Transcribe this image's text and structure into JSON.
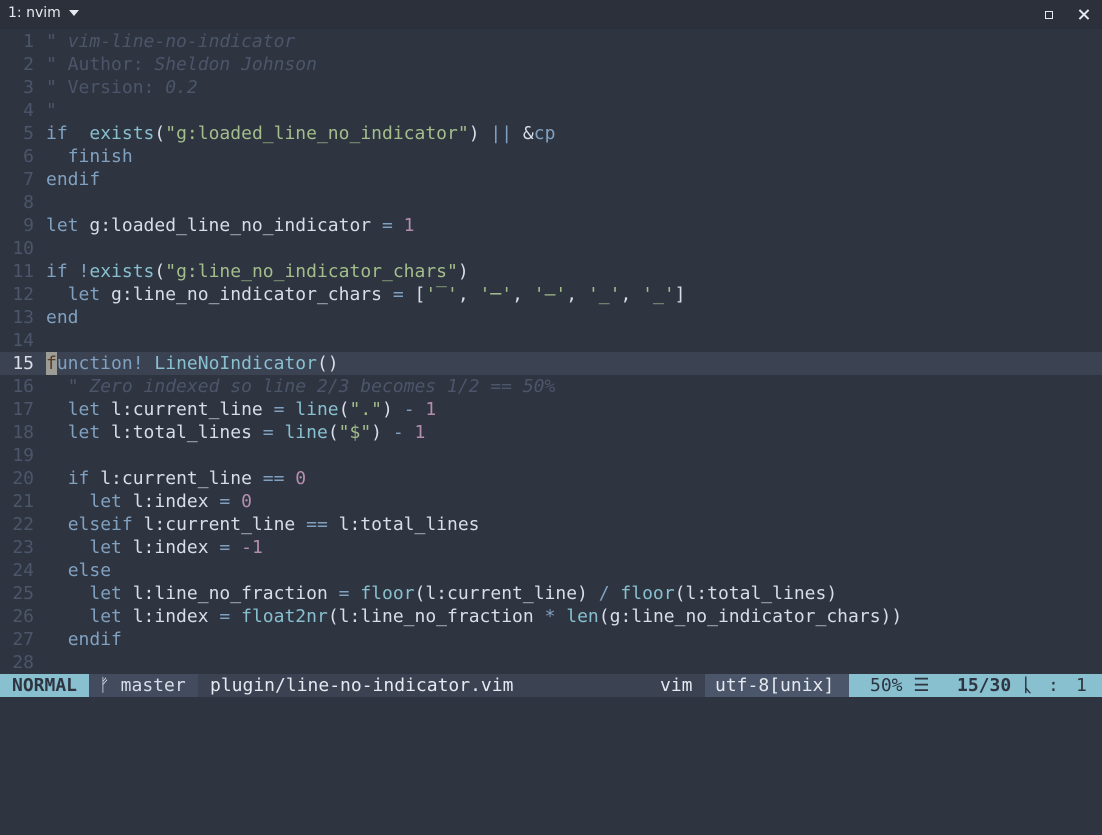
{
  "window": {
    "tab_title": "1: nvim",
    "icons": {
      "dropdown": "caret-down",
      "maximize": "square",
      "close": "x"
    }
  },
  "editor": {
    "lines": [
      {
        "n": "1",
        "t": [
          [
            "cmt-plain",
            "\" "
          ],
          [
            "cmt",
            "vim-line-no-indicator"
          ]
        ]
      },
      {
        "n": "2",
        "t": [
          [
            "cmt-plain",
            "\" Author: "
          ],
          [
            "cmt",
            "Sheldon Johnson"
          ]
        ]
      },
      {
        "n": "3",
        "t": [
          [
            "cmt-plain",
            "\" Version: "
          ],
          [
            "cmt",
            "0.2"
          ]
        ]
      },
      {
        "n": "4",
        "t": [
          [
            "cmt-plain",
            "\""
          ]
        ]
      },
      {
        "n": "5",
        "t": [
          [
            "kw",
            "if"
          ],
          [
            "",
            ""
          ],
          [
            "",
            "  "
          ],
          [
            "fn",
            "exists"
          ],
          [
            "",
            "("
          ],
          [
            "str",
            "\"g:loaded_line_no_indicator\""
          ],
          [
            "",
            ") "
          ],
          [
            "op",
            "||"
          ],
          [
            "",
            " &"
          ],
          [
            "kw",
            "cp"
          ]
        ]
      },
      {
        "n": "6",
        "t": [
          [
            "",
            "  "
          ],
          [
            "kw",
            "finish"
          ]
        ]
      },
      {
        "n": "7",
        "t": [
          [
            "kw",
            "endif"
          ]
        ]
      },
      {
        "n": "8",
        "t": []
      },
      {
        "n": "9",
        "t": [
          [
            "kw",
            "let"
          ],
          [
            "",
            " g:loaded_line_no_indicator "
          ],
          [
            "op",
            "="
          ],
          [
            "num",
            " 1"
          ]
        ]
      },
      {
        "n": "10",
        "t": []
      },
      {
        "n": "11",
        "t": [
          [
            "kw",
            "if"
          ],
          [
            "",
            " "
          ],
          [
            "op",
            "!"
          ],
          [
            "fn",
            "exists"
          ],
          [
            "",
            "("
          ],
          [
            "str",
            "\"g:line_no_indicator_chars\""
          ],
          [
            "",
            ")"
          ]
        ]
      },
      {
        "n": "12",
        "t": [
          [
            "",
            "  "
          ],
          [
            "kw",
            "let"
          ],
          [
            "",
            " g:line_no_indicator_chars "
          ],
          [
            "op",
            "="
          ],
          [
            "",
            " ["
          ],
          [
            "str",
            "'‾'"
          ],
          [
            "",
            ", "
          ],
          [
            "str",
            "'─'"
          ],
          [
            "",
            ", "
          ],
          [
            "str",
            "'–'"
          ],
          [
            "",
            ", "
          ],
          [
            "str",
            "'_'"
          ],
          [
            "",
            ", "
          ],
          [
            "str",
            "'_'"
          ],
          [
            "",
            "]"
          ]
        ]
      },
      {
        "n": "13",
        "t": [
          [
            "kw",
            "end"
          ]
        ]
      },
      {
        "n": "14",
        "t": []
      },
      {
        "n": "15",
        "cur": true,
        "t": [
          [
            "kw",
            "function"
          ],
          [
            "op",
            "!"
          ],
          [
            "",
            " "
          ],
          [
            "fn",
            "LineNoIndicator"
          ],
          [
            "",
            "()"
          ]
        ]
      },
      {
        "n": "16",
        "t": [
          [
            "",
            "  "
          ],
          [
            "cmt",
            "\" Zero indexed so line 2/3 becomes 1/2 == 50%"
          ]
        ]
      },
      {
        "n": "17",
        "t": [
          [
            "",
            "  "
          ],
          [
            "kw",
            "let"
          ],
          [
            "",
            " l:current_line "
          ],
          [
            "op",
            "="
          ],
          [
            "",
            " "
          ],
          [
            "fn",
            "line"
          ],
          [
            "",
            "("
          ],
          [
            "str",
            "\".\""
          ],
          [
            "",
            ") "
          ],
          [
            "op",
            "-"
          ],
          [
            "num",
            " 1"
          ]
        ]
      },
      {
        "n": "18",
        "t": [
          [
            "",
            "  "
          ],
          [
            "kw",
            "let"
          ],
          [
            "",
            " l:total_lines "
          ],
          [
            "op",
            "="
          ],
          [
            "",
            " "
          ],
          [
            "fn",
            "line"
          ],
          [
            "",
            "("
          ],
          [
            "str",
            "\"$\""
          ],
          [
            "",
            ") "
          ],
          [
            "op",
            "-"
          ],
          [
            "num",
            " 1"
          ]
        ]
      },
      {
        "n": "19",
        "t": []
      },
      {
        "n": "20",
        "t": [
          [
            "",
            "  "
          ],
          [
            "kw",
            "if"
          ],
          [
            "",
            " l:current_line "
          ],
          [
            "op",
            "=="
          ],
          [
            "num",
            " 0"
          ]
        ]
      },
      {
        "n": "21",
        "t": [
          [
            "",
            "    "
          ],
          [
            "kw",
            "let"
          ],
          [
            "",
            " l:index "
          ],
          [
            "op",
            "="
          ],
          [
            "num",
            " 0"
          ]
        ]
      },
      {
        "n": "22",
        "t": [
          [
            "",
            "  "
          ],
          [
            "kw",
            "elseif"
          ],
          [
            "",
            " l:current_line "
          ],
          [
            "op",
            "=="
          ],
          [
            "",
            " l:total_lines"
          ]
        ]
      },
      {
        "n": "23",
        "t": [
          [
            "",
            "    "
          ],
          [
            "kw",
            "let"
          ],
          [
            "",
            " l:index "
          ],
          [
            "op",
            "="
          ],
          [
            "",
            " "
          ],
          [
            "num",
            "-1"
          ]
        ]
      },
      {
        "n": "24",
        "t": [
          [
            "",
            "  "
          ],
          [
            "kw",
            "else"
          ]
        ]
      },
      {
        "n": "25",
        "t": [
          [
            "",
            "    "
          ],
          [
            "kw",
            "let"
          ],
          [
            "",
            " l:line_no_fraction "
          ],
          [
            "op",
            "="
          ],
          [
            "",
            " "
          ],
          [
            "fn",
            "floor"
          ],
          [
            "",
            "(l:current_line) "
          ],
          [
            "op",
            "/"
          ],
          [
            "",
            " "
          ],
          [
            "fn",
            "floor"
          ],
          [
            "",
            "(l:total_lines)"
          ]
        ]
      },
      {
        "n": "26",
        "t": [
          [
            "",
            "    "
          ],
          [
            "kw",
            "let"
          ],
          [
            "",
            " l:index "
          ],
          [
            "op",
            "="
          ],
          [
            "",
            " "
          ],
          [
            "fn",
            "float2nr"
          ],
          [
            "",
            "(l:line_no_fraction "
          ],
          [
            "op",
            "*"
          ],
          [
            "",
            " "
          ],
          [
            "fn",
            "len"
          ],
          [
            "",
            "(g:line_no_indicator_chars))"
          ]
        ]
      },
      {
        "n": "27",
        "t": [
          [
            "",
            "  "
          ],
          [
            "kw",
            "endif"
          ]
        ]
      },
      {
        "n": "28",
        "t": []
      }
    ]
  },
  "status": {
    "mode": "NORMAL",
    "branch_icon": "ᚠ",
    "branch": "master",
    "file": "plugin/line-no-indicator.vim",
    "filetype": "vim",
    "encoding": "utf-8[unix]",
    "percent": "50%",
    "lines_icon": "☰",
    "line_col": "15/30",
    "ln_icon": "ᚳ",
    "colon": ":",
    "column": "1"
  },
  "colors": {
    "background": "#2e3440",
    "cursorline": "#3b4252",
    "keyword": "#81a1c1",
    "function": "#88c0d0",
    "string": "#a3be8c",
    "number": "#b48ead",
    "comment": "#4c566a"
  }
}
